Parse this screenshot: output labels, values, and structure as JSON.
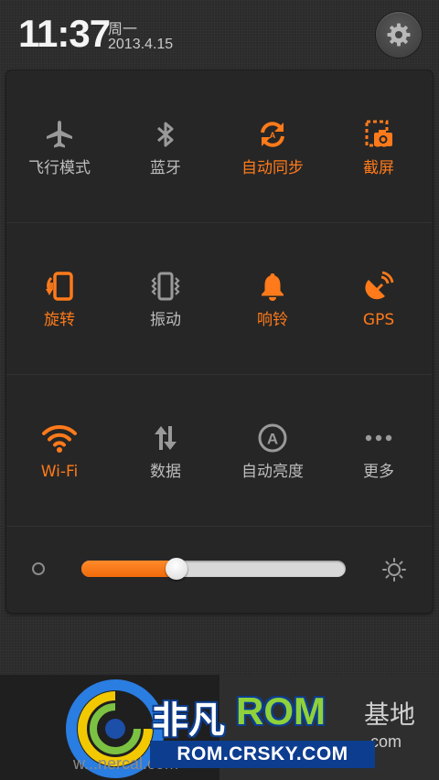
{
  "status": {
    "time": "11:37",
    "weekday": "周一",
    "date": "2013.4.15"
  },
  "settings_icon": "gear-icon",
  "colors": {
    "accent": "#ff7a1a",
    "inactive": "#bdbdbd",
    "panel": "#262626"
  },
  "toggles": [
    {
      "label": "飞行模式",
      "icon": "airplane-icon",
      "on": false
    },
    {
      "label": "蓝牙",
      "icon": "bluetooth-icon",
      "on": false
    },
    {
      "label": "自动同步",
      "icon": "sync-icon",
      "on": true
    },
    {
      "label": "截屏",
      "icon": "screenshot-icon",
      "on": true
    },
    {
      "label": "旋转",
      "icon": "rotate-icon",
      "on": true
    },
    {
      "label": "振动",
      "icon": "vibrate-icon",
      "on": false
    },
    {
      "label": "响铃",
      "icon": "bell-icon",
      "on": true
    },
    {
      "label": "GPS",
      "icon": "gps-icon",
      "on": true
    },
    {
      "label": "Wi-Fi",
      "icon": "wifi-icon",
      "on": true
    },
    {
      "label": "数据",
      "icon": "data-icon",
      "on": false
    },
    {
      "label": "自动亮度",
      "icon": "auto-brightness-icon",
      "on": false
    },
    {
      "label": "更多",
      "icon": "more-icon",
      "on": false
    }
  ],
  "brightness": {
    "level": 0.36,
    "low_icon": "brightness-low-icon",
    "high_icon": "brightness-high-icon"
  },
  "watermark": {
    "brand_cn": "非凡",
    "brand_en": "ROM",
    "faint_text": "基地",
    "faint_text2": ".com",
    "url": "ROM.CRSKY.COM",
    "url2": "w...nercal.com"
  }
}
